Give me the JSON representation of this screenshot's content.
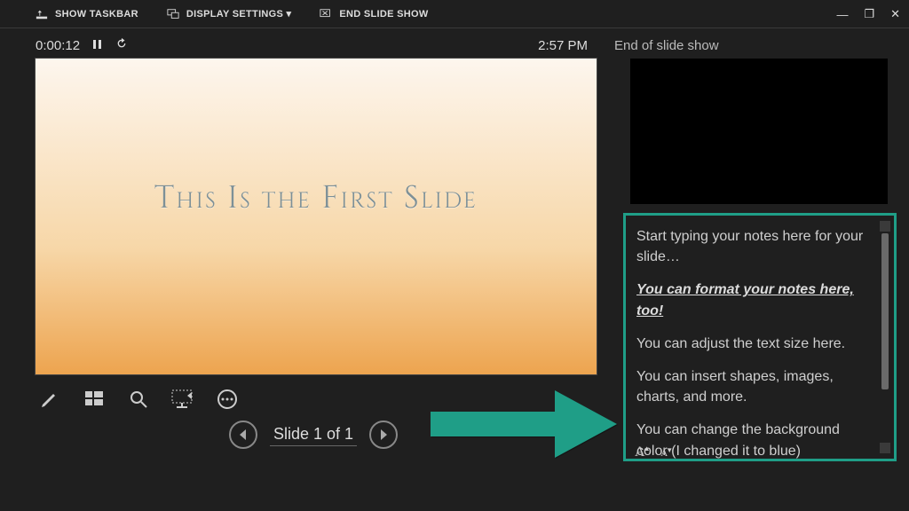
{
  "toolbar": {
    "show_taskbar": "SHOW TASKBAR",
    "display_settings": "DISPLAY SETTINGS ▾",
    "end_show": "END SLIDE SHOW"
  },
  "timer": "0:00:12",
  "clock": "2:57 PM",
  "next_label": "End of slide show",
  "slide": {
    "title": "This Is the First Slide"
  },
  "nav": {
    "counter": "Slide 1 of 1"
  },
  "notes": {
    "p1": "Start typing your notes here for your slide…",
    "p2": "You can format your notes here, too!",
    "p3": "You can adjust the text size here.",
    "p4": "You can insert shapes, images, charts, and more.",
    "p5": "You can change the background color (I changed it to blue)"
  },
  "colors": {
    "accent_green": "#1f9e87"
  }
}
